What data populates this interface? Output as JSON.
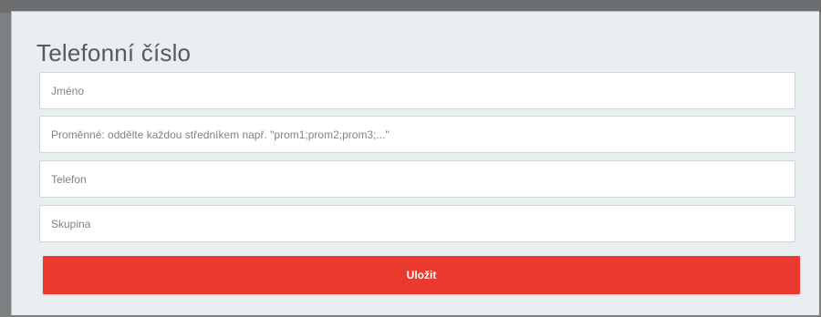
{
  "form": {
    "title": "Telefonní číslo",
    "fields": [
      {
        "name": "name",
        "placeholder": "Jméno",
        "value": ""
      },
      {
        "name": "variables",
        "placeholder": "Proměnné: oddělte každou středníkem např. \"prom1;prom2;prom3;...\"",
        "value": ""
      },
      {
        "name": "phone",
        "placeholder": "Telefon",
        "value": ""
      },
      {
        "name": "group",
        "placeholder": "Skupina",
        "value": ""
      }
    ],
    "save_label": "Uložit"
  },
  "colors": {
    "accent": "#ea3a30",
    "panel_background": "#e9eef1",
    "backdrop": "#7d7f80"
  }
}
